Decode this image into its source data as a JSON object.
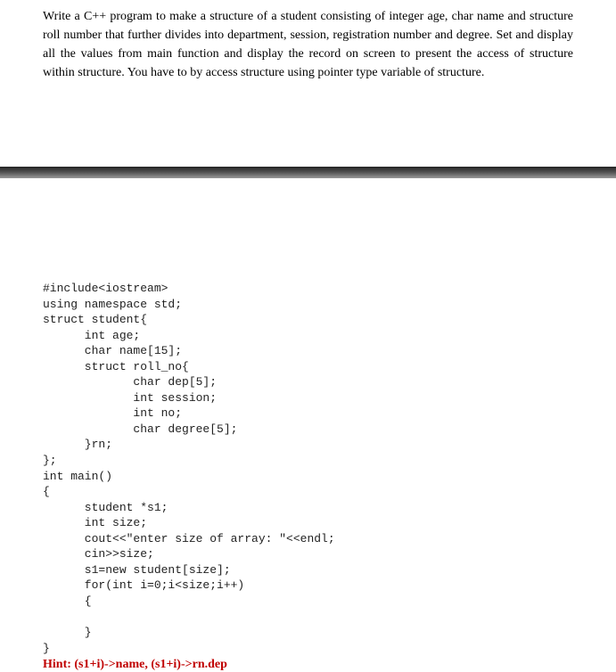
{
  "question": {
    "paragraph": "Write a C++ program to make a structure of a student consisting of integer age, char name and structure roll number that further divides into department, session, registration number and degree. Set and display all the values from main function and display the record on screen to present the access of structure within structure. You have to by access structure using pointer type variable of structure."
  },
  "code": {
    "text": "#include<iostream>\nusing namespace std;\nstruct student{\n      int age;\n      char name[15];\n      struct roll_no{\n             char dep[5];\n             int session;\n             int no;\n             char degree[5];\n      }rn;\n};\nint main()\n{\n      student *s1;\n      int size;\n      cout<<\"enter size of array: \"<<endl;\n      cin>>size;\n      s1=new student[size];\n      for(int i=0;i<size;i++)\n      {\n\n      }\n}"
  },
  "hint": {
    "text": "Hint: (s1+i)->name, (s1+i)->rn.dep"
  }
}
